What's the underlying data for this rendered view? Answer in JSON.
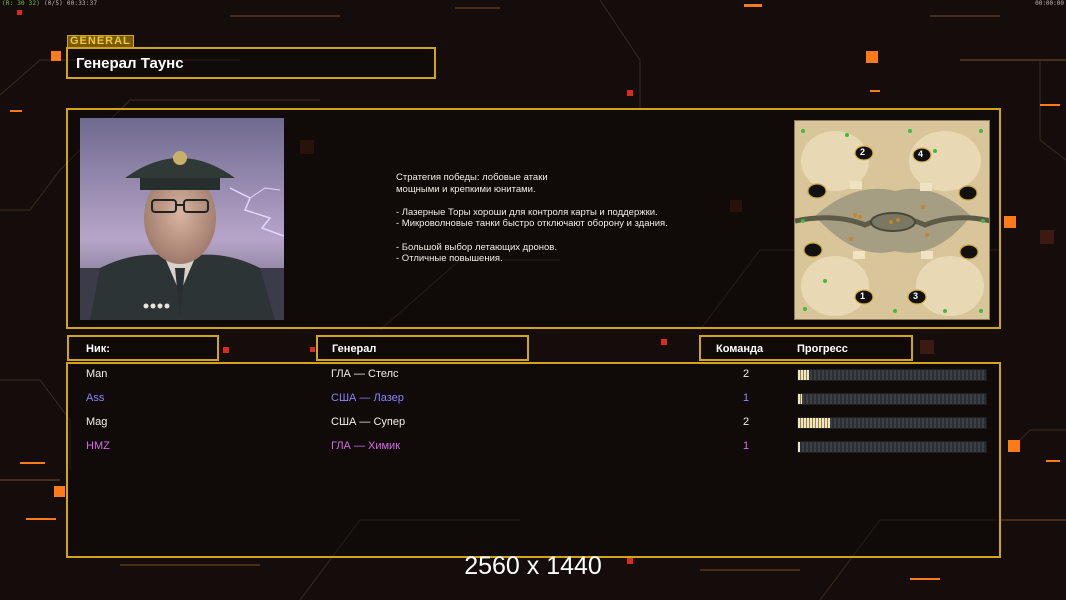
{
  "hud": {
    "top_left_fps": "(R: 30 32)",
    "top_left_extra": "(0/5)",
    "top_left_time": "00:33:37",
    "top_right_time": "00:00:00"
  },
  "general_tag": "GENERAL",
  "general_name": "Генерал Таунс",
  "description": [
    "Стратегия победы: лобовые атаки",
    "мощными и крепкими юнитами.",
    "",
    "- Лазерные Торы хороши для контроля карты и поддержки.",
    "- Микроволновые танки быстро отключают оборону и здания.",
    "",
    "- Большой выбор летающих дронов.",
    "- Отличные повышения."
  ],
  "map": {
    "start_positions": [
      "1",
      "2",
      "3",
      "4"
    ]
  },
  "columns": {
    "nick": "Ник:",
    "general": "Генерал",
    "team": "Команда",
    "progress": "Прогресс"
  },
  "players": [
    {
      "nick": "Man",
      "general": "ГЛА — Стелс",
      "team": "2",
      "progress": 0.06,
      "color": "#f2eee8"
    },
    {
      "nick": "Ass",
      "general": "США — Лазер",
      "team": "1",
      "progress": 0.02,
      "color": "#8c83ff"
    },
    {
      "nick": "Mag",
      "general": "США — Супер",
      "team": "2",
      "progress": 0.17,
      "color": "#f2eee8"
    },
    {
      "nick": "HMZ",
      "general": "ГЛА — Химик",
      "team": "1",
      "progress": 0.01,
      "color": "#d46be6"
    }
  ],
  "resolution_label": "2560 x 1440",
  "colors": {
    "accent_gold": "#d3a516",
    "accent_orange": "#ff8a1c",
    "background": "#140d0b"
  }
}
